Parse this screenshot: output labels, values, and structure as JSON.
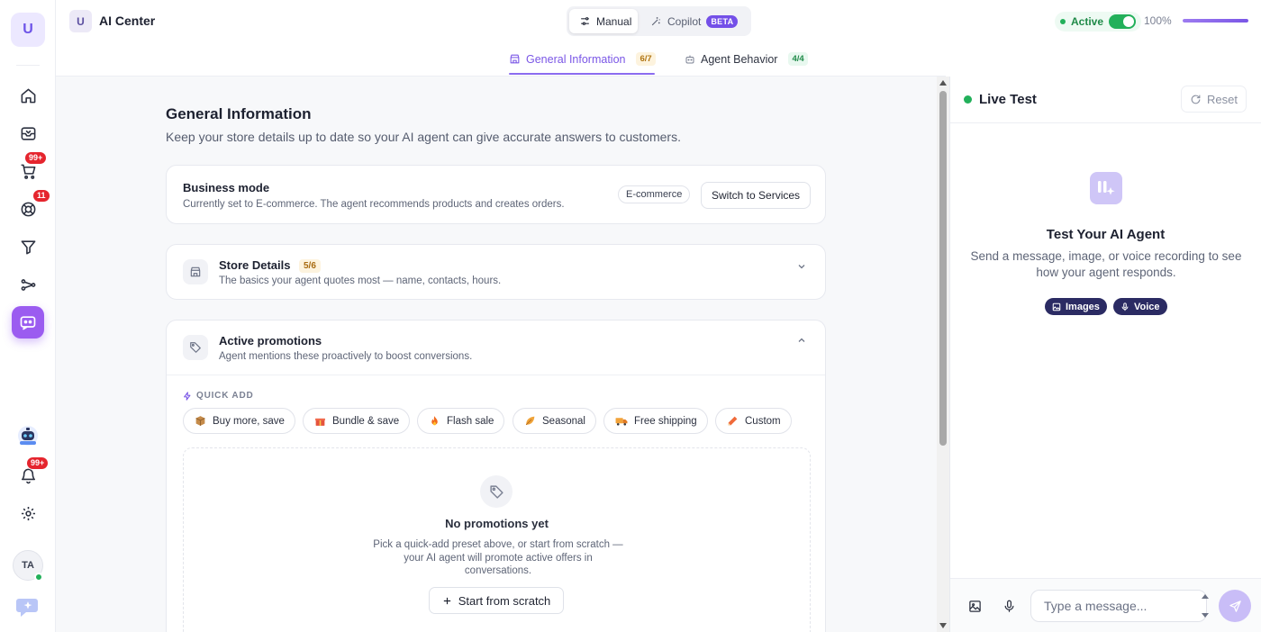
{
  "rail": {
    "logo_letter": "U",
    "badges": {
      "cart": "99+",
      "support": "11",
      "notifications": "99+"
    },
    "avatar_initials": "TA"
  },
  "topbar": {
    "app_letter": "U",
    "app_title": "AI Center",
    "mode_manual": "Manual",
    "mode_copilot": "Copilot",
    "beta": "BETA",
    "status": "Active",
    "progress_label": "100%",
    "progress_fraction": 1.0
  },
  "tabs": [
    {
      "label": "General Information",
      "count": "6/7"
    },
    {
      "label": "Agent Behavior",
      "count": "4/4"
    }
  ],
  "main": {
    "title": "General Information",
    "subtitle": "Keep your store details up to date so your AI agent can give accurate answers to customers.",
    "business": {
      "title": "Business mode",
      "subtitle": "Currently set to E-commerce. The agent recommends products and creates orders.",
      "chip": "E-commerce",
      "switch_label": "Switch to Services"
    },
    "store": {
      "title": "Store Details",
      "count": "5/6",
      "subtitle": "The basics your agent quotes most — name, contacts, hours."
    },
    "promotions": {
      "title": "Active promotions",
      "subtitle": "Agent mentions these proactively to boost conversions.",
      "quick_add": "QUICK ADD",
      "presets": [
        "Buy more, save",
        "Bundle & save",
        "Flash sale",
        "Seasonal",
        "Free shipping",
        "Custom"
      ],
      "empty_title": "No promotions yet",
      "empty_line1": "Pick a quick-add preset above, or start from scratch —",
      "empty_line2": "your AI agent will promote active offers in",
      "empty_line3": "conversations.",
      "scratch_label": "Start from scratch"
    }
  },
  "panel": {
    "title": "Live Test",
    "reset": "Reset",
    "test_title": "Test Your AI Agent",
    "test_sub_1": "Send a message, image, or voice recording to see",
    "test_sub_2": "how your agent responds.",
    "chip_images": "Images",
    "chip_voice": "Voice",
    "input_placeholder": "Type a message..."
  },
  "colors": {
    "accent": "#7a56e6",
    "active_green": "#22b05a",
    "badge_red": "#e5252e",
    "chip_dark": "#2b2b63"
  }
}
